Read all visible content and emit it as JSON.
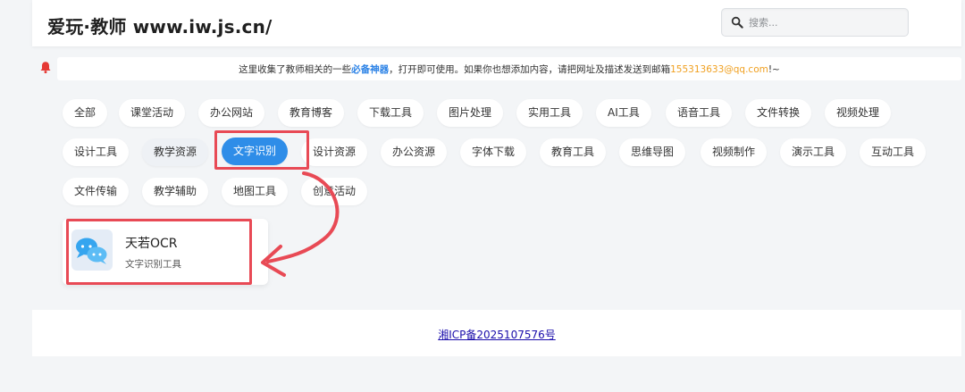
{
  "header": {
    "site_title": "爱玩·教师 www.iw.js.cn/"
  },
  "search": {
    "placeholder": "搜索..."
  },
  "notice": {
    "text_before": "这里收集了教师相关的一些",
    "highlight": "必备神器",
    "text_middle": "，打开即可使用。如果你也想添加内容，请把网址及描述发送到邮箱",
    "email": "155313633@qq.com",
    "text_after": "!~"
  },
  "categories": [
    "全部",
    "课堂活动",
    "办公网站",
    "教育博客",
    "下载工具",
    "图片处理",
    "实用工具",
    "AI工具",
    "语音工具",
    "文件转换",
    "视频处理",
    "设计工具",
    "教学资源",
    "文字识别",
    "设计资源",
    "办公资源",
    "字体下载",
    "教育工具",
    "思维导图",
    "视频制作",
    "演示工具",
    "互动工具",
    "文件传输",
    "教学辅助",
    "地图工具",
    "创意活动"
  ],
  "active_category": "文字识别",
  "card": {
    "title": "天若OCR",
    "description": "文字识别工具"
  },
  "footer": {
    "icp": "湘ICP备2025107576号"
  },
  "colors": {
    "accent": "#2e8de8",
    "annotation": "#e84a55",
    "email": "#f0a020"
  }
}
